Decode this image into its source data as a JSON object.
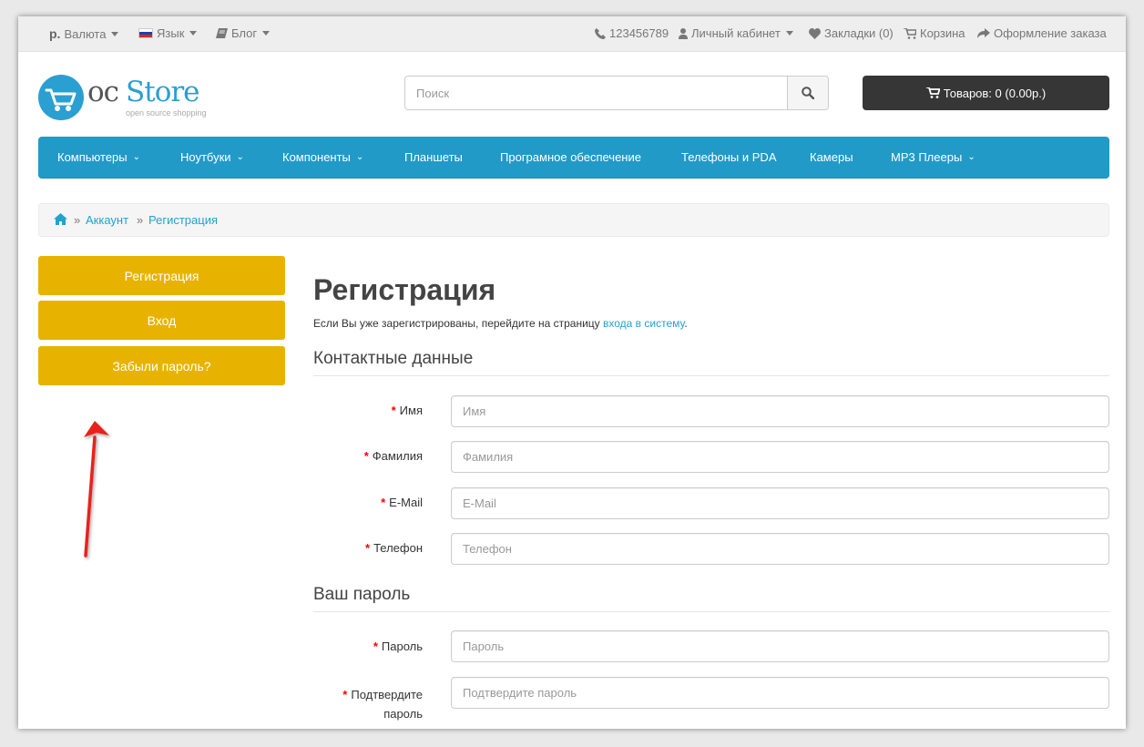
{
  "topbar": {
    "currency_symbol": "р.",
    "currency_label": "Валюта",
    "language_label": "Язык",
    "blog_label": "Блог",
    "phone": "123456789",
    "account_label": "Личный кабинет",
    "wishlist_label": "Закладки (0)",
    "cart_label": "Корзина",
    "checkout_label": "Оформление заказа"
  },
  "logo": {
    "oc": "oc",
    "store": "Store",
    "tagline": "open source shopping"
  },
  "search": {
    "placeholder": "Поиск",
    "value": ""
  },
  "cart_button": {
    "label": "Товаров: 0 (0.00р.)"
  },
  "menu": {
    "items": [
      {
        "label": "Компьютеры",
        "dropdown": true
      },
      {
        "label": "Ноутбуки",
        "dropdown": true
      },
      {
        "label": "Компоненты",
        "dropdown": true
      },
      {
        "label": "Планшеты",
        "dropdown": false
      },
      {
        "label": "Програмное обеспечение",
        "dropdown": false
      },
      {
        "label": "Телефоны и PDA",
        "dropdown": false
      },
      {
        "label": "Камеры",
        "dropdown": false
      },
      {
        "label": "MP3 Плееры",
        "dropdown": true
      }
    ]
  },
  "breadcrumb": {
    "items": [
      "Аккаунт",
      "Регистрация"
    ],
    "separator": "»"
  },
  "sidebar": {
    "buttons": [
      "Регистрация",
      "Вход",
      "Забыли пароль?"
    ],
    "button_color": "#e7b300"
  },
  "main": {
    "title": "Регистрация",
    "intro_text": "Если Вы уже зарегистрированы, перейдите на страницу ",
    "intro_link": "входа в систему",
    "intro_end": ".",
    "contact_legend": "Контактные данные",
    "password_legend": "Ваш пароль",
    "required_mark": "*",
    "fields": {
      "firstname": {
        "label": "Имя",
        "placeholder": "Имя",
        "value": ""
      },
      "lastname": {
        "label": "Фамилия",
        "placeholder": "Фамилия",
        "value": ""
      },
      "email": {
        "label": "E-Mail",
        "placeholder": "E-Mail",
        "value": ""
      },
      "phone": {
        "label": "Телефон",
        "placeholder": "Телефон",
        "value": ""
      },
      "password": {
        "label": "Пароль",
        "placeholder": "Пароль",
        "value": ""
      },
      "confirm_line1": "Подтвердите",
      "confirm_line2": "пароль",
      "confirm": {
        "placeholder": "Подтвердите пароль",
        "value": ""
      }
    }
  },
  "colors": {
    "accent": "#229ac8",
    "link": "#23a1d1",
    "dark": "#363636",
    "annotation": "#e8221b"
  },
  "annotation": {
    "icon": "red-arrow-icon"
  }
}
